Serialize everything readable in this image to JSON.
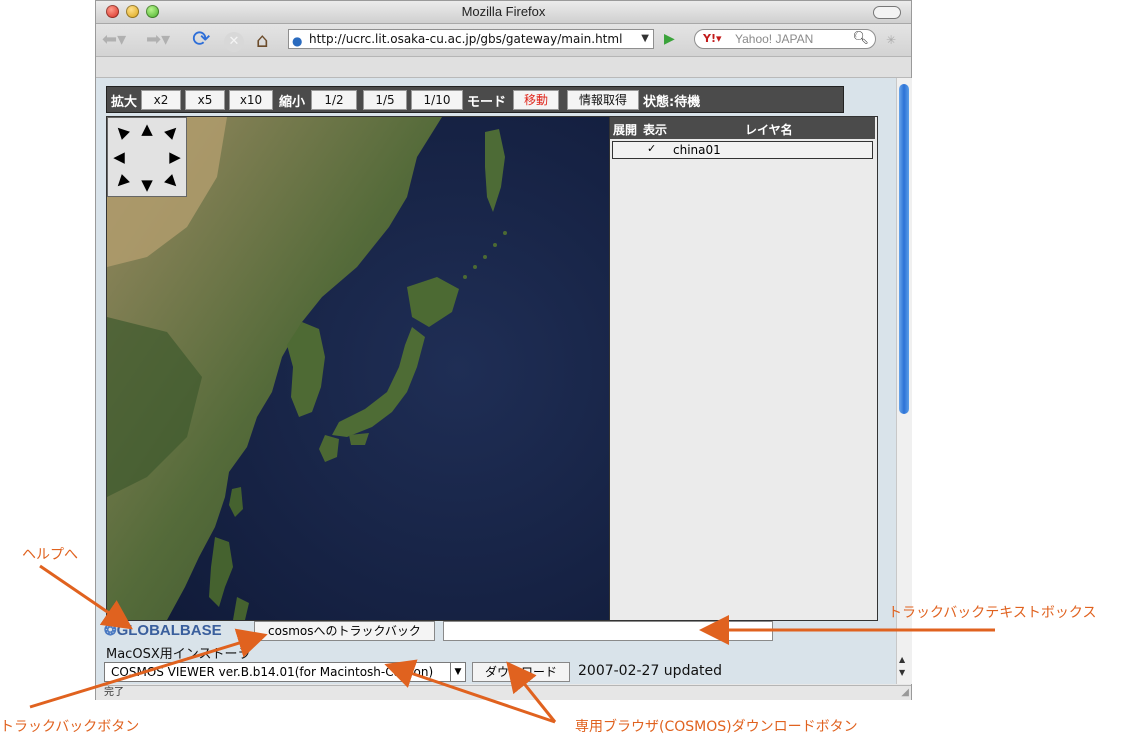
{
  "window": {
    "title": "Mozilla Firefox",
    "url": "http://ucrc.lit.osaka-cu.ac.jp/gbs/gateway/main.html",
    "search_engine": "Y!",
    "search_placeholder": "Yahoo! JAPAN",
    "status": "完了"
  },
  "toolbar": {
    "zoom_in_label": "拡大",
    "zoom_in_buttons": [
      "x2",
      "x5",
      "x10"
    ],
    "zoom_out_label": "縮小",
    "zoom_out_buttons": [
      "1/2",
      "1/5",
      "1/10"
    ],
    "mode_label": "モード",
    "mode_move": "移動",
    "mode_info": "情報取得",
    "state": "状態:待機",
    "accent_active": "#e0261b"
  },
  "layer_panel": {
    "headers": [
      "展開",
      "表示",
      "レイヤ名"
    ],
    "layers": [
      {
        "expand": "",
        "visible": "✓",
        "name": "china01"
      }
    ]
  },
  "footer": {
    "logo": "GLOBALBASE",
    "trackback_button": "cosmosへのトラックバック",
    "trackback_value": "",
    "installer_label": "MacOSX用インストーラ",
    "viewer_selected": "COSMOS VIEWER ver.B.b14.01(for Macintosh-Carbon)",
    "download_button": "ダウンロード",
    "updated": "2007-02-27 updated"
  },
  "annotations": {
    "help": "ヘルプへ",
    "trackback_textbox": "トラックバックテキストボックス",
    "trackback_button": "トラックバックボタン",
    "download_button": "専用ブラウザ(COSMOS)ダウンロードボタン",
    "color": "#e0621f"
  },
  "icons": [
    "back-arrow-icon",
    "forward-arrow-icon",
    "reload-icon",
    "stop-icon",
    "home-icon",
    "globe-icon",
    "go-icon",
    "search-icon",
    "throbber-icon"
  ]
}
